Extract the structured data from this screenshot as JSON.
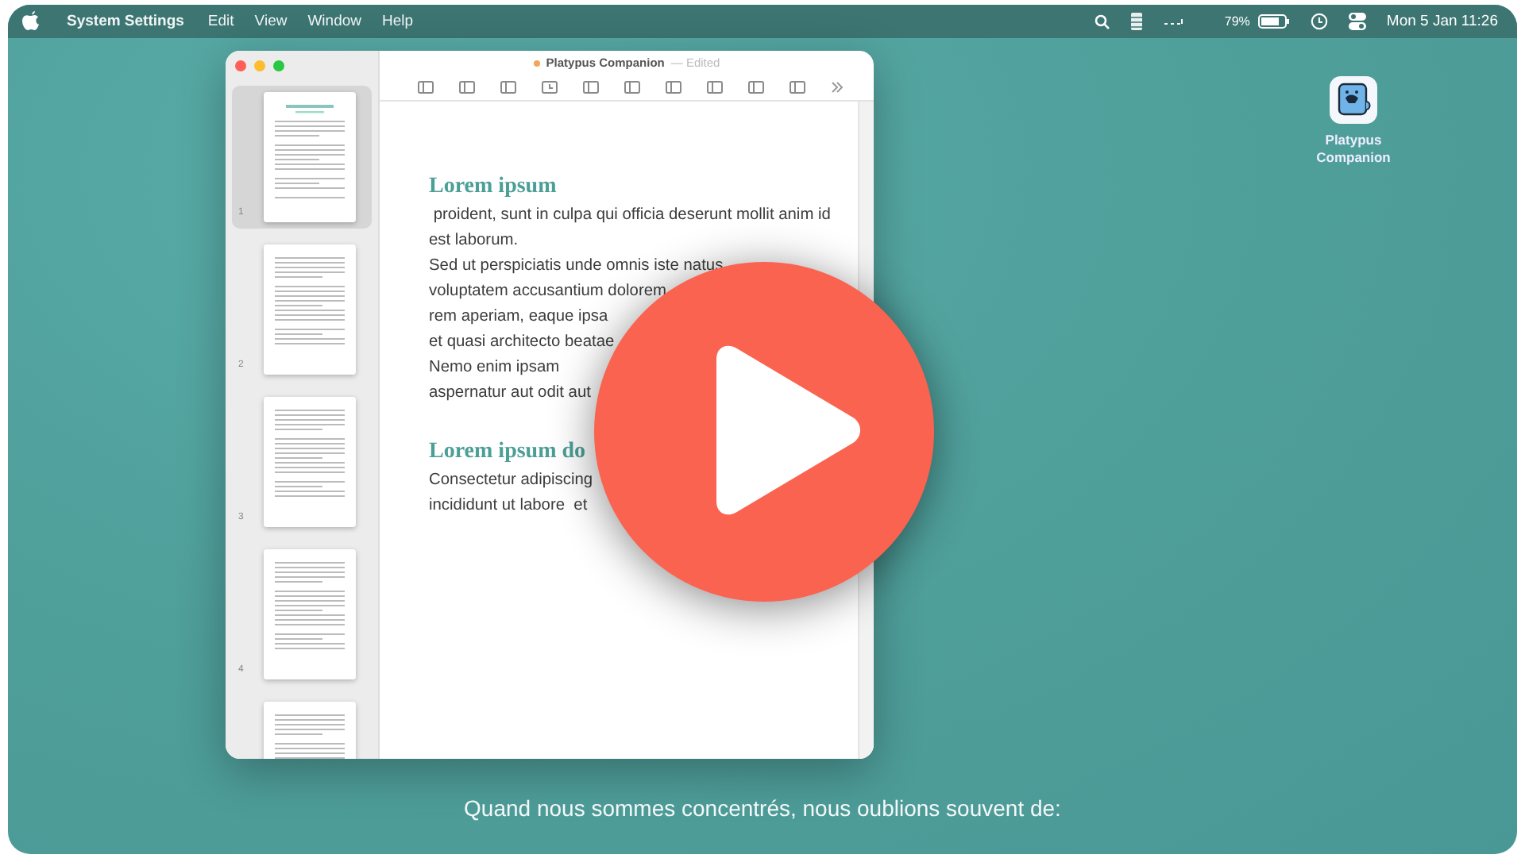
{
  "menu_bar": {
    "app_name": "System Settings",
    "menus": [
      "Edit",
      "View",
      "Window",
      "Help"
    ],
    "battery": "79%",
    "clock": "Mon 5 Jan  11:26"
  },
  "window": {
    "title": "Platypus Companion",
    "status": "— Edited"
  },
  "pages": [
    {
      "number": "1",
      "selected": true
    },
    {
      "number": "2",
      "selected": false
    },
    {
      "number": "3",
      "selected": false
    },
    {
      "number": "4",
      "selected": false
    },
    {
      "selected": false
    }
  ],
  "document": {
    "sections": [
      {
        "heading": "Lorem ipsum",
        "lines": [
          " proident, sunt in culpa qui officia deserunt mollit anim id",
          "est laborum.",
          "Sed ut perspiciatis unde omnis iste natus",
          "voluptatem accusantium dolorem",
          "rem aperiam, eaque ipsa",
          "et quasi architecto beatae",
          "Nemo enim ipsam",
          "aspernatur aut odit aut"
        ]
      },
      {
        "heading": "Lorem ipsum do",
        "lines": [
          "Consectetur adipiscing",
          "incididunt ut labore  et"
        ]
      }
    ]
  },
  "desktop_icon": {
    "label": "Platypus Companion"
  },
  "subtitle": "Quand nous sommes concentrés, nous oublions souvent de:"
}
